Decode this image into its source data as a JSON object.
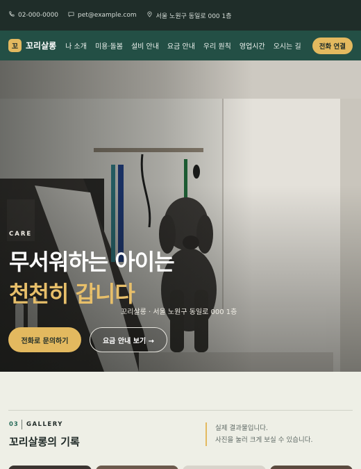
{
  "topbar": {
    "phone": "02-000-0000",
    "email": "pet@example.com",
    "address": "서울 노원구 동일로 000 1층"
  },
  "nav": {
    "logo_mark": "꼬",
    "brand": "꼬리살롱",
    "links": [
      "나 소개",
      "미용·돌봄",
      "설비 안내",
      "요금 안내",
      "우리 원칙",
      "영업시간",
      "오시는 길"
    ],
    "call_button": "전화 연결"
  },
  "hero": {
    "eyebrow": "CARE",
    "headline_line1": "무서워하는 아이는",
    "headline_line2": "천천히 갑니다",
    "address_line": "꼬리살롱 · 서울 노원구 동일로 000 1층",
    "primary_button": "전화로 문의하기",
    "secondary_button": "요금 안내 보기 →"
  },
  "gallery": {
    "number": "03",
    "tag": "GALLERY",
    "title": "꼬리살롱의 기록",
    "note_line1": "실제 결과물입니다.",
    "note_line2": "사진을 눌러 크게 보실 수 있습니다."
  },
  "colors": {
    "topbar_bg": "#1f2d29",
    "nav_bg": "#234f45",
    "accent": "#e3b95f",
    "page_bg": "#eeefe6"
  }
}
